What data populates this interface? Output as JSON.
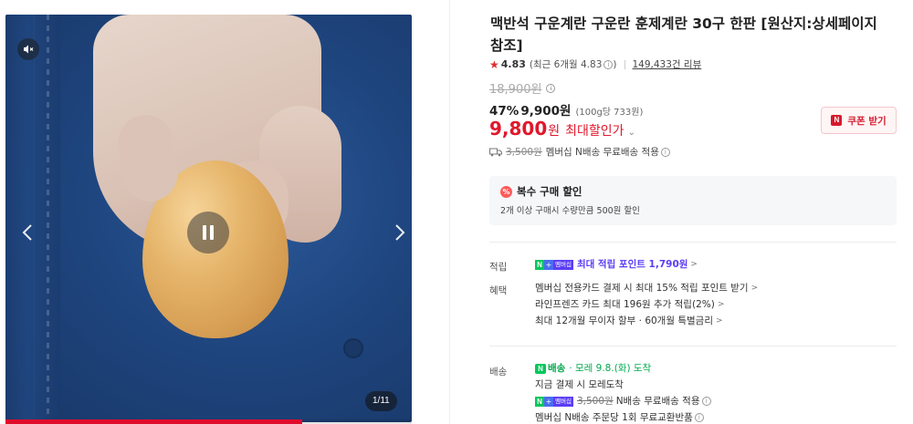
{
  "media": {
    "counter": "1/11",
    "progress_fraction": 0.73,
    "icons": [
      "mute-icon",
      "pause-icon",
      "chevron-left-icon",
      "chevron-right-icon"
    ]
  },
  "product": {
    "title": "맥반석 구운계란 구운란 훈제계란 30구 한판 [원산지:상세페이지 참조]",
    "rating": {
      "score": "4.83",
      "recent": "(최근 6개월 4.83",
      "recent_close": ")",
      "reviews": "149,433건 리뷰"
    },
    "original_price": "18,900원",
    "discount_pct": "47%",
    "sale_price": "9,900원",
    "unit_price": "(100g당 733원)",
    "max_price_number": "9,800",
    "max_price_won": "원",
    "max_label": "최대할인가",
    "coupon_label": "쿠폰 받기",
    "shipping": {
      "original": "3,500원",
      "text": "멤버십 N배송 무료배송 적용"
    }
  },
  "bulk": {
    "title": "복수 구매 할인",
    "desc": "2개 이상 구매시 수량만큼 500원 할인"
  },
  "points": {
    "label": "적립",
    "badge_mem": "멤버십",
    "text": "최대 적립 포인트 1,790원",
    "chev": ">"
  },
  "benefits": {
    "label": "혜택",
    "lines": [
      "멤버십 전용카드 결제 시 최대 15% 적립 포인트 받기",
      "라인프렌즈 카드 최대 196원 추가 적립(2%)",
      "최대 12개월 무이자 할부 · 60개월 특별금리"
    ]
  },
  "delivery": {
    "label": "배송",
    "badge": "배송",
    "eta": "· 모레 9.8.(화) 도착",
    "line2": "지금 결제 시 모레도착",
    "badge_mem": "멤버십",
    "line3_strike": "3,500원",
    "line3_text": "N배송 무료배송 적용",
    "line4": "멤버십 N배송 주문당 1회 무료교환반품"
  },
  "colors": {
    "accent_red": "#e0182c",
    "npay_green": "#03c75a",
    "membership_purple": "#5b3df5"
  }
}
